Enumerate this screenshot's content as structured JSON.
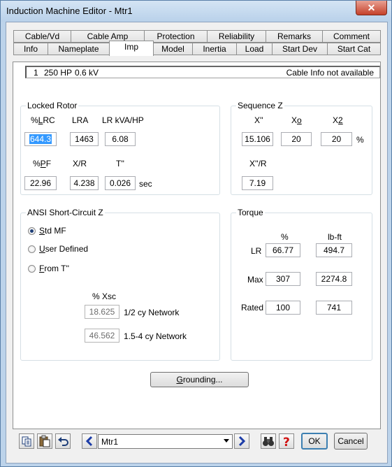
{
  "window": {
    "title": "Induction Machine Editor - Mtr1",
    "close_glyph": "✕"
  },
  "tabs": {
    "row1": [
      "Cable/Vd",
      "Cable Amp",
      "Protection",
      "Reliability",
      "Remarks",
      "Comment"
    ],
    "row2": [
      "Info",
      "Nameplate",
      "Imp",
      "Model",
      "Inertia",
      "Load",
      "Start Dev",
      "Start Cat"
    ],
    "active": "Imp"
  },
  "info_bar": {
    "id": "1",
    "hp": "250 HP",
    "kv": "0.6 kV",
    "cable_status": "Cable Info not available"
  },
  "locked_rotor": {
    "title": "Locked Rotor",
    "lrc_label_pre": "%",
    "lrc_label_u": "L",
    "lrc_label_post": "RC",
    "lra_label": "LRA",
    "lrkva_label": "LR kVA/HP",
    "lrc_value": "644.3",
    "lra_value": "1463",
    "lrkva_value": "6.08",
    "pf_label_pre": "%",
    "pf_label_u": "P",
    "pf_label_post": "F",
    "xr_label": "X/R",
    "t_label": "T''",
    "pf_value": "22.96",
    "xr_value": "4.238",
    "t_value": "0.026",
    "t_unit": "sec"
  },
  "sequence_z": {
    "title": "Sequence Z",
    "x_label": "X''",
    "x0_label_pre": "X",
    "x0_label_u": "o",
    "x2_label_pre": "X",
    "x2_label_u": "2",
    "x_value": "15.106",
    "x0_value": "20",
    "x2_value": "20",
    "unit": "%",
    "xr_label": "X''/R",
    "xr_value": "7.19"
  },
  "ansi": {
    "title": "ANSI  Short-Circuit  Z",
    "options": [
      {
        "pre": "",
        "u": "S",
        "post": "td MF",
        "selected": true
      },
      {
        "pre": "",
        "u": "U",
        "post": "ser Defined",
        "selected": false
      },
      {
        "pre": "",
        "u": "F",
        "post": "rom T''",
        "selected": false
      }
    ],
    "xsc_label": "% Xsc",
    "half_cy_value": "18.625",
    "half_cy_label": "1/2 cy Network",
    "cy15_value": "46.562",
    "cy15_label": "1.5-4 cy Network"
  },
  "torque": {
    "title": "Torque",
    "pct_header": "%",
    "lbft_header": "lb-ft",
    "rows": [
      {
        "label": "LR",
        "pct": "66.77",
        "lbft": "494.7"
      },
      {
        "label": "Max",
        "pct": "307",
        "lbft": "2274.8"
      },
      {
        "label": "Rated",
        "pct": "100",
        "lbft": "741"
      }
    ]
  },
  "grounding_button": {
    "u": "G",
    "post": "rounding..."
  },
  "bottom": {
    "combo_value": "Mtr1",
    "ok_label": "OK",
    "cancel_label": "Cancel",
    "icons": [
      "copy-icon",
      "paste-icon",
      "undo-icon",
      "previous-icon",
      "next-icon",
      "find-icon",
      "help-icon"
    ]
  }
}
